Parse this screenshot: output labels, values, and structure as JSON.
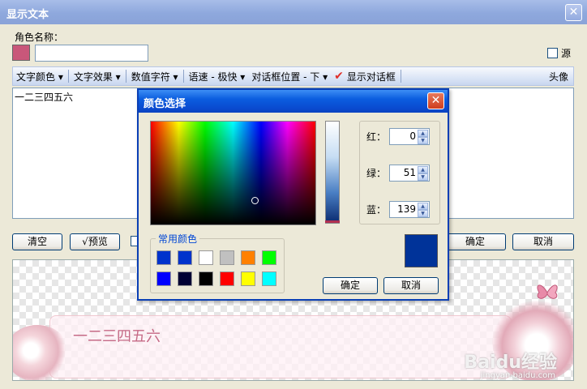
{
  "window": {
    "title": "显示文本",
    "close_glyph": "✕"
  },
  "name_label": "角色名称：",
  "name_value": "",
  "name_color": "#c9577a",
  "source_label": "源",
  "toolbar": {
    "items": [
      "文字颜色 ▾",
      "文字效果 ▾",
      "数值字符 ▾",
      "语速 - 极快 ▾",
      "对话框位置 - 下 ▾"
    ],
    "show_dialog_check": "✔",
    "show_dialog_label": "显示对话框",
    "avatar_label": "头像"
  },
  "text_content": "一二三四五六",
  "buttons": {
    "clear": "清空",
    "preview": "√预览",
    "ok": "确定",
    "cancel": "取消"
  },
  "preview_text": "一二三四五六",
  "watermark": "Baidu经验",
  "watermark_url": "jingyan.baidu.com",
  "color_dialog": {
    "title": "颜色选择",
    "close_glyph": "✕",
    "red_label": "红：",
    "red_value": "0",
    "green_label": "绿：",
    "green_value": "51",
    "blue_label": "蓝：",
    "blue_value": "139",
    "common_colors_label": "常用颜色",
    "common_colors": [
      "#0033cc",
      "#0033cc",
      "#ffffff",
      "#c0c0c0",
      "#ff8000",
      "#00ff00",
      "#0000ff",
      "#000033",
      "#000000",
      "#ff0000",
      "#ffff00",
      "#00ffff"
    ],
    "current_color": "#003399",
    "ok": "确定",
    "cancel": "取消"
  }
}
